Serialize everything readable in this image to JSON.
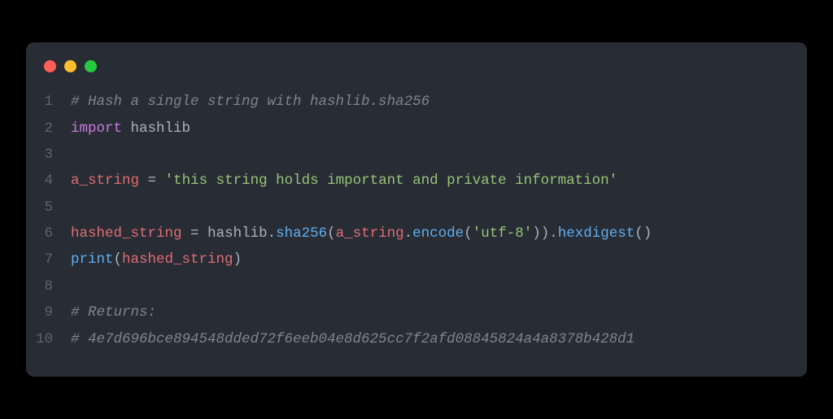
{
  "window": {
    "traffic_lights": [
      "red",
      "yellow",
      "green"
    ]
  },
  "code": {
    "lines": [
      {
        "n": "1",
        "tokens": [
          {
            "c": "tok-comment",
            "t": "# Hash a single string with hashlib.sha256"
          }
        ]
      },
      {
        "n": "2",
        "tokens": [
          {
            "c": "tok-keyword",
            "t": "import"
          },
          {
            "c": "",
            "t": " "
          },
          {
            "c": "tok-module",
            "t": "hashlib"
          }
        ]
      },
      {
        "n": "3",
        "tokens": []
      },
      {
        "n": "4",
        "tokens": [
          {
            "c": "tok-var",
            "t": "a_string"
          },
          {
            "c": "",
            "t": " "
          },
          {
            "c": "tok-op",
            "t": "="
          },
          {
            "c": "",
            "t": " "
          },
          {
            "c": "tok-string",
            "t": "'this string holds important and private information'"
          }
        ]
      },
      {
        "n": "5",
        "tokens": []
      },
      {
        "n": "6",
        "tokens": [
          {
            "c": "tok-var",
            "t": "hashed_string"
          },
          {
            "c": "",
            "t": " "
          },
          {
            "c": "tok-op",
            "t": "="
          },
          {
            "c": "",
            "t": " "
          },
          {
            "c": "tok-module",
            "t": "hashlib"
          },
          {
            "c": "tok-punct",
            "t": "."
          },
          {
            "c": "tok-method",
            "t": "sha256"
          },
          {
            "c": "tok-punct",
            "t": "("
          },
          {
            "c": "tok-var",
            "t": "a_string"
          },
          {
            "c": "tok-punct",
            "t": "."
          },
          {
            "c": "tok-method",
            "t": "encode"
          },
          {
            "c": "tok-punct",
            "t": "("
          },
          {
            "c": "tok-string",
            "t": "'utf-8'"
          },
          {
            "c": "tok-punct",
            "t": "))."
          },
          {
            "c": "tok-method",
            "t": "hexdigest"
          },
          {
            "c": "tok-punct",
            "t": "()"
          }
        ]
      },
      {
        "n": "7",
        "tokens": [
          {
            "c": "tok-func",
            "t": "print"
          },
          {
            "c": "tok-punct",
            "t": "("
          },
          {
            "c": "tok-var",
            "t": "hashed_string"
          },
          {
            "c": "tok-punct",
            "t": ")"
          }
        ]
      },
      {
        "n": "8",
        "tokens": []
      },
      {
        "n": "9",
        "tokens": [
          {
            "c": "tok-comment",
            "t": "# Returns:"
          }
        ]
      },
      {
        "n": "10",
        "tokens": [
          {
            "c": "tok-comment",
            "t": "# 4e7d696bce894548dded72f6eeb04e8d625cc7f2afd08845824a4a8378b428d1"
          }
        ]
      }
    ]
  }
}
